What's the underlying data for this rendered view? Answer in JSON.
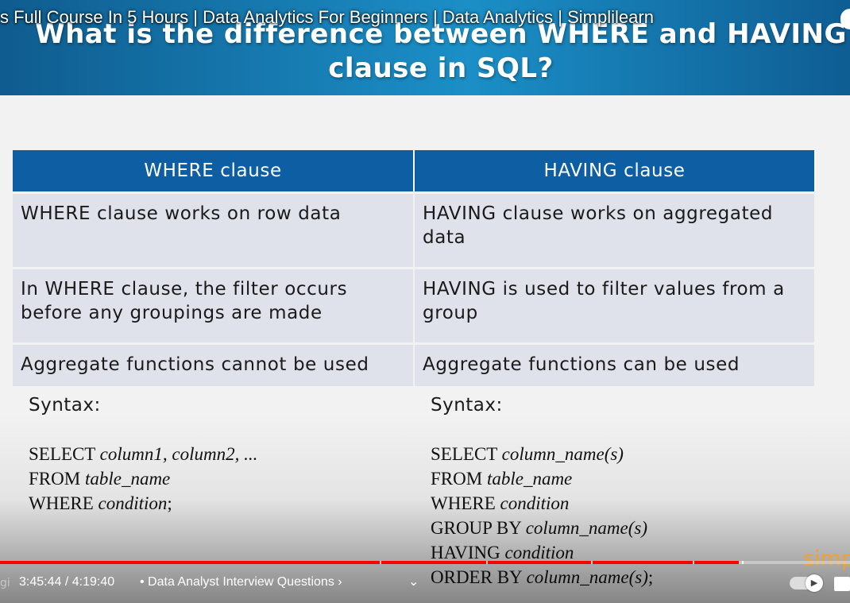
{
  "video": {
    "title": "s Full Course In 5 Hours | Data Analytics For Beginners | Data Analytics | Simplilearn",
    "time_label": "3:45:44 / 4:19:40",
    "chapter_label": "• Data Analyst Interview Questions ›",
    "progress_percent": 86.9,
    "ghost_text": "gi",
    "logo_text": "simp"
  },
  "slide": {
    "title_line1": "What is the difference between WHERE and HAVING",
    "title_line2": "clause in SQL?",
    "table": {
      "headers": [
        "WHERE clause",
        "HAVING clause"
      ],
      "rows": [
        [
          "WHERE clause works on row data",
          "HAVING clause works on aggregated data"
        ],
        [
          "In WHERE clause, the filter occurs before any groupings are made",
          "HAVING is used to  filter values from a group"
        ],
        [
          "Aggregate functions cannot be used",
          "Aggregate functions can be used"
        ]
      ]
    },
    "where_syntax": {
      "label": "Syntax:",
      "lines": [
        {
          "kw": "SELECT",
          "arg": "column1, column2, ..."
        },
        {
          "kw": "FROM",
          "arg": "table_name"
        },
        {
          "kw": "WHERE",
          "arg": "condition",
          "tail": ";"
        }
      ]
    },
    "having_syntax": {
      "label": "Syntax:",
      "lines": [
        {
          "kw": "SELECT",
          "arg": "column_name(s)"
        },
        {
          "kw": "FROM",
          "arg": "table_name"
        },
        {
          "kw": "WHERE",
          "arg": "condition"
        },
        {
          "kw": "GROUP BY",
          "arg": "column_name(s)"
        },
        {
          "kw": "HAVING",
          "arg": "condition"
        },
        {
          "kw": "ORDER BY",
          "arg": "column_name(s)",
          "tail": ";"
        }
      ]
    }
  },
  "colors": {
    "header_blue": "#0d5ea3",
    "cell_bg": "#dfe1eb",
    "progress_red": "#ff0000",
    "logo_orange": "#f2a12e"
  }
}
